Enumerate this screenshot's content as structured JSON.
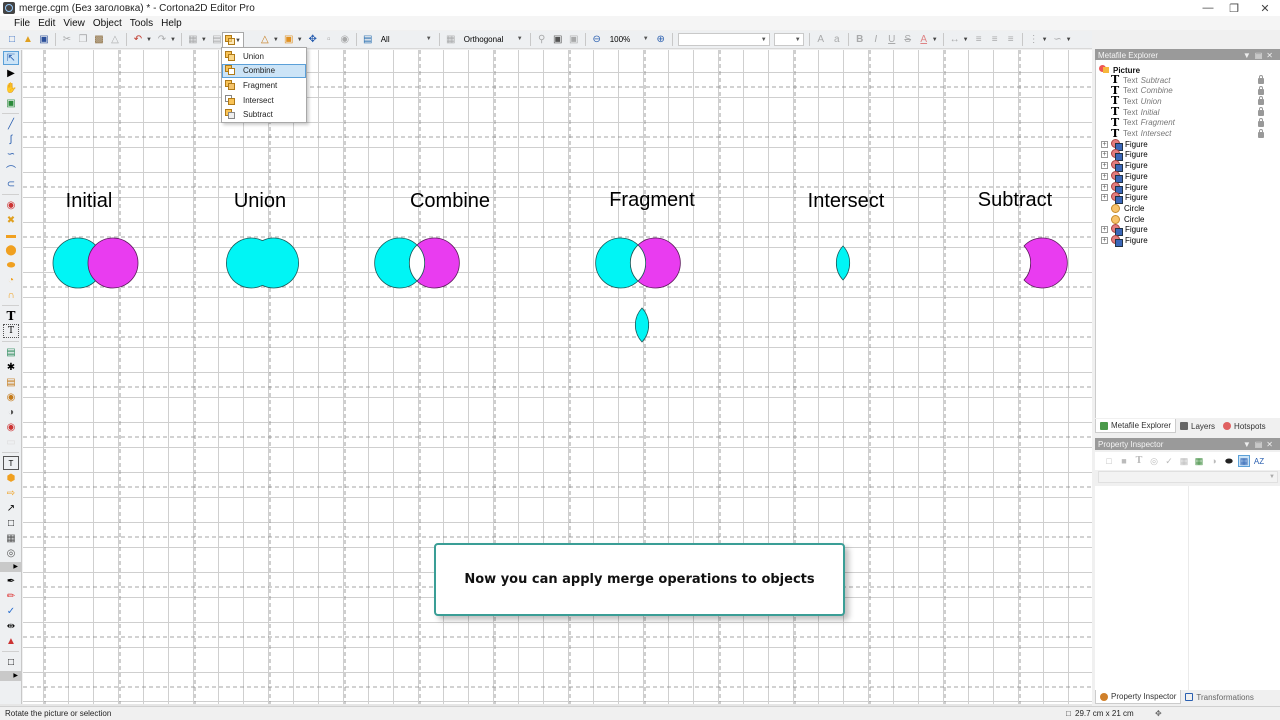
{
  "window": {
    "title": "merge.cgm (Без заголовка) * - Cortona2D Editor Pro",
    "controls": [
      "minimize",
      "restore",
      "close"
    ]
  },
  "menubar": {
    "items": [
      "File",
      "Edit",
      "View",
      "Object",
      "Tools",
      "Help"
    ]
  },
  "toolbar": {
    "layer_select": "All",
    "connector_select": "Orthogonal",
    "zoom_select": "100%",
    "font_select": "",
    "font_size_select": ""
  },
  "merge_menu": {
    "items": [
      {
        "label": "Union",
        "selected": false
      },
      {
        "label": "Combine",
        "selected": true
      },
      {
        "label": "Fragment",
        "selected": false
      },
      {
        "label": "Intersect",
        "selected": false
      },
      {
        "label": "Subtract",
        "selected": false
      }
    ]
  },
  "canvas": {
    "labels": [
      "Initial",
      "Union",
      "Combine",
      "Fragment",
      "Intersect",
      "Subtract"
    ],
    "colors": {
      "cyan": "#00f5f5",
      "magenta": "#e93cf0",
      "stroke": "#1a5a5a"
    },
    "hint": "Now you can apply merge operations to objects"
  },
  "metafile_explorer": {
    "title": "Metafile Explorer",
    "root": "Picture",
    "items": [
      {
        "kind": "Text",
        "name": "Subtract",
        "type": "text",
        "locked": true
      },
      {
        "kind": "Text",
        "name": "Combine",
        "type": "text",
        "locked": true
      },
      {
        "kind": "Text",
        "name": "Union",
        "type": "text",
        "locked": true
      },
      {
        "kind": "Text",
        "name": "Initial",
        "type": "text",
        "locked": true
      },
      {
        "kind": "Text",
        "name": "Fragment",
        "type": "text",
        "locked": true
      },
      {
        "kind": "Text",
        "name": "Intersect",
        "type": "text",
        "locked": true
      },
      {
        "kind": "Figure",
        "name": "",
        "type": "figure",
        "locked": false
      },
      {
        "kind": "Figure",
        "name": "",
        "type": "figure",
        "locked": false
      },
      {
        "kind": "Figure",
        "name": "",
        "type": "figure",
        "locked": false
      },
      {
        "kind": "Figure",
        "name": "",
        "type": "figure",
        "locked": false
      },
      {
        "kind": "Figure",
        "name": "",
        "type": "figure",
        "locked": false
      },
      {
        "kind": "Figure",
        "name": "",
        "type": "figure",
        "locked": false
      },
      {
        "kind": "Circle",
        "name": "",
        "type": "circle",
        "locked": false
      },
      {
        "kind": "Circle",
        "name": "",
        "type": "circle",
        "locked": false
      },
      {
        "kind": "Figure",
        "name": "",
        "type": "figure",
        "locked": false
      },
      {
        "kind": "Figure",
        "name": "",
        "type": "figure",
        "locked": false
      }
    ],
    "tabs": [
      "Metafile Explorer",
      "Layers",
      "Hotspots"
    ]
  },
  "property_inspector": {
    "title": "Property Inspector",
    "tabs": [
      "Property Inspector",
      "Transformations"
    ]
  },
  "statusbar": {
    "message": "Rotate the picture or selection",
    "page_size": "29.7 cm x 21 cm"
  }
}
